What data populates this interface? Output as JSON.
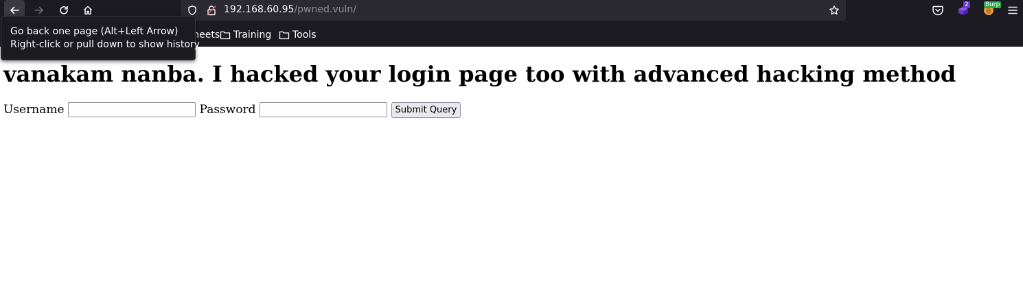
{
  "browser": {
    "url_host": "192.168.60.95",
    "url_path": "/pwned.vuln/",
    "extension_badges": {
      "container_count": "2",
      "burp_label": "Burp"
    },
    "icons": {
      "back": "back-arrow-icon",
      "forward": "forward-arrow-icon",
      "reload": "reload-icon",
      "home": "home-icon",
      "tracking": "shield-icon",
      "insecure": "insecure-lock-icon",
      "bookmark_star": "star-icon",
      "pocket": "pocket-icon",
      "menu": "hamburger-menu-icon",
      "folder": "folder-icon"
    },
    "bookmarks": [
      {
        "label": "heat sheets"
      },
      {
        "label": "Training"
      },
      {
        "label": "Tools"
      }
    ],
    "tooltip": {
      "line1": "Go back one page (Alt+Left Arrow)",
      "line2": "Right-click or pull down to show history"
    }
  },
  "page": {
    "heading": "vanakam nanba. I hacked your login page too with advanced hacking method",
    "form": {
      "username_label": "Username",
      "username_value": "",
      "password_label": "Password",
      "password_value": "",
      "submit_label": "Submit Query"
    }
  },
  "colors": {
    "chrome_bg": "#1c1b22",
    "urlbar_bg": "#2b2a33",
    "chrome_text": "#fbfbfe",
    "url_path_text": "#8f8f9d",
    "page_bg": "#ffffff",
    "heading_text": "#000000",
    "container_badge": "#6b38d6",
    "burp_badge": "#2ea94f"
  }
}
